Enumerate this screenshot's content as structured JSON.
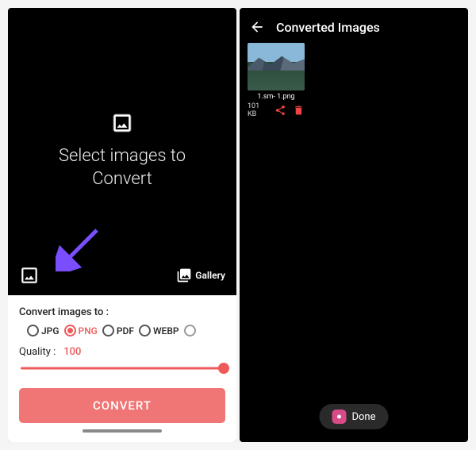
{
  "left": {
    "select_text_line1": "Select images to",
    "select_text_line2": "Convert",
    "gallery_label": "Gallery",
    "convert_label": "Convert images to :",
    "formats": [
      "JPG",
      "PNG",
      "PDF",
      "WEBP"
    ],
    "selected_format": "PNG",
    "quality_label": "Quality :",
    "quality_value": "100",
    "convert_button": "CONVERT"
  },
  "right": {
    "title": "Converted Images",
    "thumb_name": "1.sm- 1.png",
    "thumb_size": "101 KB",
    "done_label": "Done"
  },
  "colors": {
    "accent": "#ee5a5a",
    "button": "#f07575",
    "arrow": "#7a4dff"
  }
}
